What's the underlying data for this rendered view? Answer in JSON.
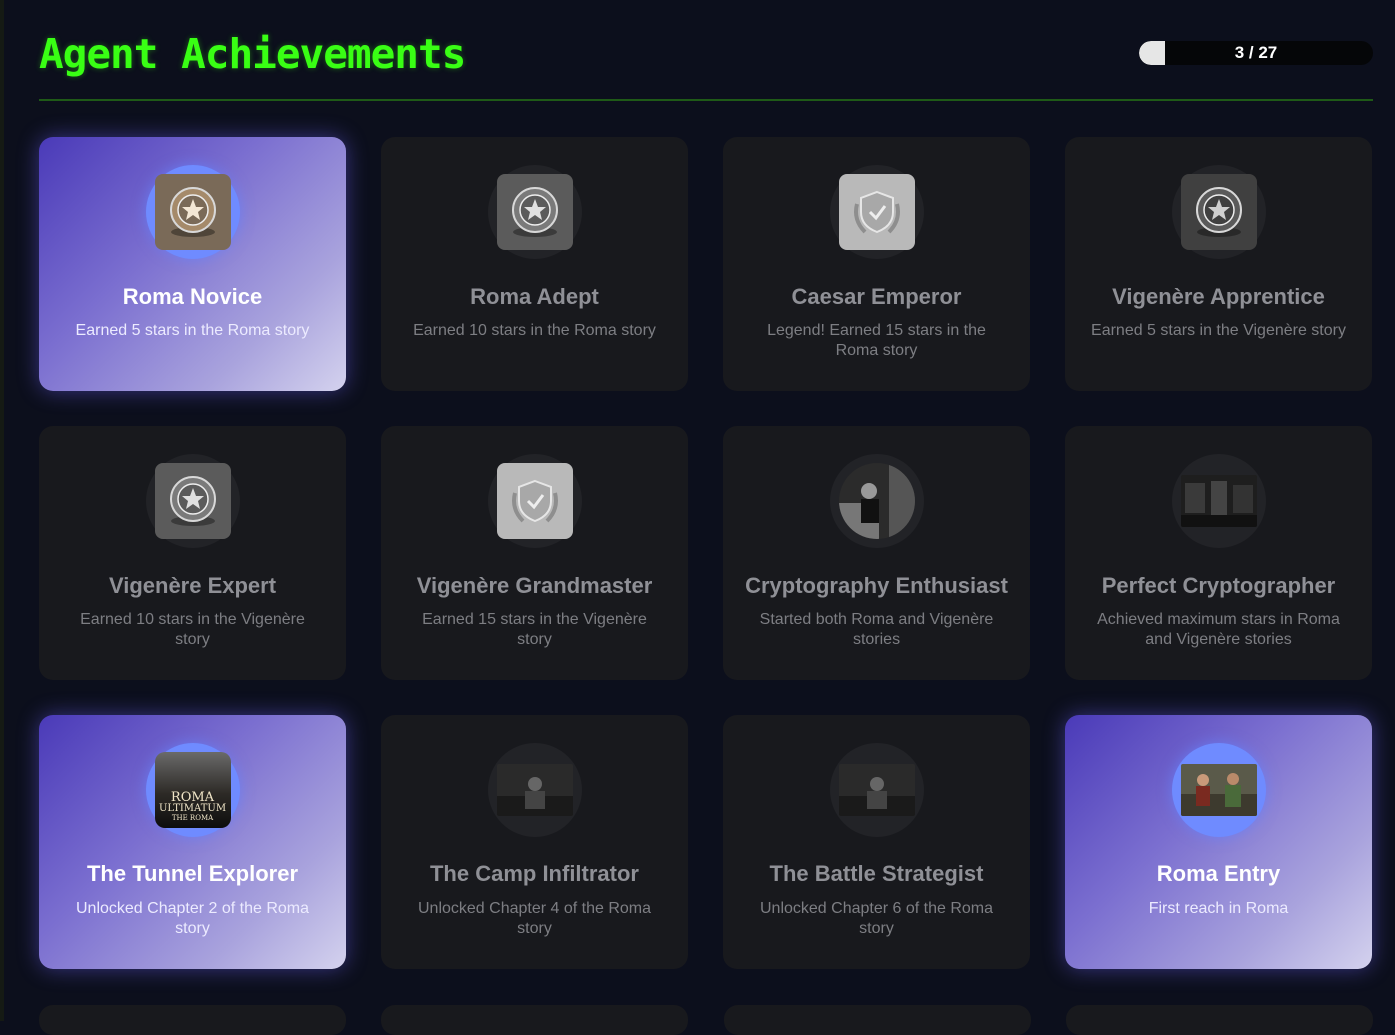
{
  "title": "Agent Achievements",
  "progress": {
    "label": "3 / 27",
    "fraction": 0.111
  },
  "achievements": [
    {
      "title": "Roma Novice",
      "desc": "Earned 5 stars in the Roma story",
      "unlocked": true,
      "icon": "bronze-star-medal-icon",
      "icon_style": "medal-bronze"
    },
    {
      "title": "Roma Adept",
      "desc": "Earned 10 stars in the Roma story",
      "unlocked": false,
      "icon": "silver-star-medal-icon",
      "icon_style": "medal-silver"
    },
    {
      "title": "Caesar Emperor",
      "desc": "Legend! Earned 15 stars in the Roma story",
      "unlocked": false,
      "icon": "laurel-shield-icon",
      "icon_style": "shield"
    },
    {
      "title": "Vigenère Apprentice",
      "desc": "Earned 5 stars in the Vigenère story",
      "unlocked": false,
      "icon": "star-medal-icon",
      "icon_style": "medal-dark"
    },
    {
      "title": "Vigenère Expert",
      "desc": "Earned 10 stars in the Vigenère story",
      "unlocked": false,
      "icon": "silver-star-medal-icon",
      "icon_style": "medal-silver"
    },
    {
      "title": "Vigenère Grandmaster",
      "desc": "Earned 15 stars in the Vigenère story",
      "unlocked": false,
      "icon": "laurel-shield-icon",
      "icon_style": "shield"
    },
    {
      "title": "Cryptography Enthusiast",
      "desc": "Started both Roma and Vigenère stories",
      "unlocked": false,
      "icon": "agent-scene-icon",
      "icon_style": "scene-round"
    },
    {
      "title": "Perfect Cryptographer",
      "desc": "Achieved maximum stars in Roma and Vigenère stories",
      "unlocked": false,
      "icon": "office-scene-icon",
      "icon_style": "scene-wide"
    },
    {
      "title": "The Tunnel Explorer",
      "desc": "Unlocked Chapter 2 of the Roma story",
      "unlocked": true,
      "icon": "roma-ultimatum-poster-icon",
      "icon_style": "poster",
      "poster_lines": [
        "ROMA",
        "ULTIMATUM",
        "THE ROMA"
      ]
    },
    {
      "title": "The Camp Infiltrator",
      "desc": "Unlocked Chapter 4 of the Roma story",
      "unlocked": false,
      "icon": "soldier-scene-icon",
      "icon_style": "scene"
    },
    {
      "title": "The Battle Strategist",
      "desc": "Unlocked Chapter 6 of the Roma story",
      "unlocked": false,
      "icon": "arena-scene-icon",
      "icon_style": "scene"
    },
    {
      "title": "Roma Entry",
      "desc": "First reach in Roma",
      "unlocked": true,
      "icon": "fight-scene-icon",
      "icon_style": "scene-color"
    }
  ]
}
